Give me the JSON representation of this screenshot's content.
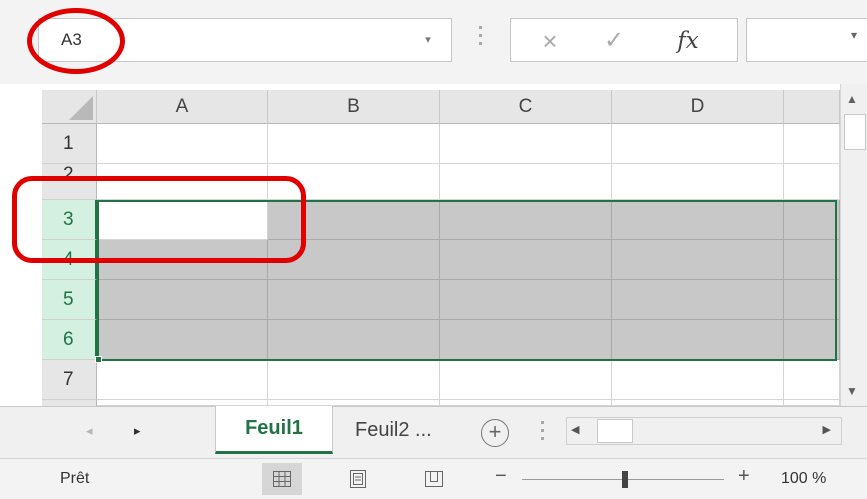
{
  "formula_bar": {
    "name_box_value": "A3",
    "dropdown_icon": "▾",
    "cancel_icon": "×",
    "enter_icon": "✓",
    "function_icon": "fx",
    "expand_icon": "▾"
  },
  "grid": {
    "columns": [
      "A",
      "B",
      "C",
      "D"
    ],
    "rows": [
      "1",
      "2",
      "3",
      "4",
      "5",
      "6",
      "7"
    ],
    "active_cell": "A3",
    "selected_range": "A3:D6",
    "colors": {
      "selection_border": "#217346",
      "selection_fill": "#c8c8c8",
      "header_fill": "#e6e6e6"
    }
  },
  "sheets": {
    "tabs": [
      "Feuil1",
      "Feuil2 ..."
    ],
    "active": "Feuil1",
    "add_icon": "+",
    "prev_icon": "◂",
    "next_icon": "▸"
  },
  "status_bar": {
    "ready_text": "Prêt",
    "zoom_level": "100 %",
    "zoom_out_icon": "−",
    "zoom_in_icon": "+"
  },
  "annotations": {
    "color": "#e00000"
  }
}
